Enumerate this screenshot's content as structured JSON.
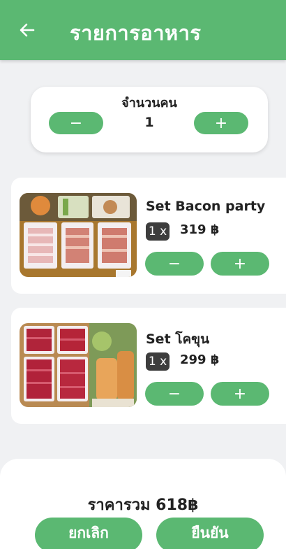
{
  "header": {
    "title": "รายการอาหาร"
  },
  "people": {
    "label": "จำนวนคน",
    "count": "1",
    "minus": "−",
    "plus": "+"
  },
  "items": [
    {
      "name": "Set Bacon party",
      "qty": "1 x",
      "price": "319 ฿",
      "minus": "−",
      "plus": "+"
    },
    {
      "name": "Set โคขุน",
      "qty": "1 x",
      "price": "299 ฿",
      "minus": "−",
      "plus": "+"
    }
  ],
  "footer": {
    "total": "ราคารวม 618฿",
    "cancel": "ยกเลิก",
    "confirm": "ยืนยัน"
  },
  "colors": {
    "primary": "#5bb872",
    "badge": "#3d3d3d",
    "background": "#f0f1f3"
  },
  "icons": {
    "back": "arrow-left-icon"
  }
}
